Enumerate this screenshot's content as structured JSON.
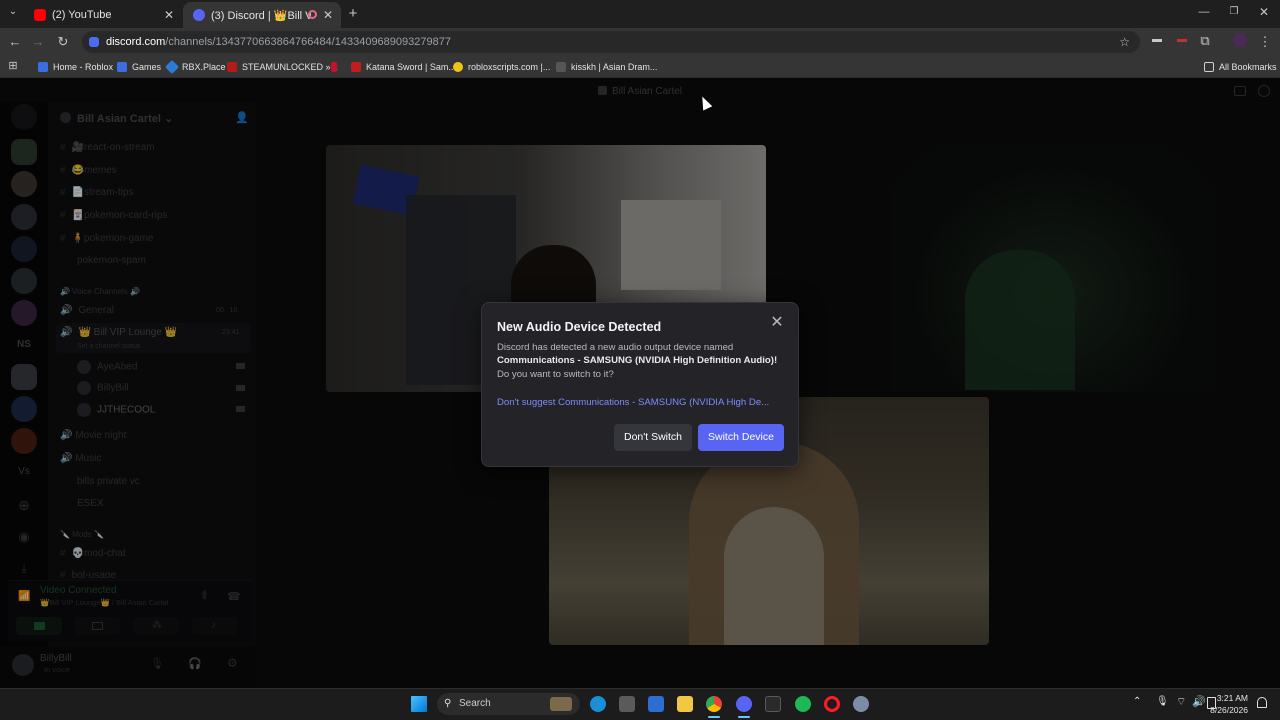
{
  "browser": {
    "tabs": [
      {
        "title": "(2) YouTube"
      },
      {
        "title": "(3) Discord | 👑Bill VIP Lou"
      }
    ],
    "url_host": "discord.com",
    "url_path": "/channels/1343770663864766484/1433409689093279877",
    "bookmarks": [
      {
        "label": "Home - Roblox"
      },
      {
        "label": "Games"
      },
      {
        "label": "RBX.Place"
      },
      {
        "label": "STEAMUNLOCKED »..."
      },
      {
        "label": "Katana Sword | Sam..."
      },
      {
        "label": "robloxscripts.com |..."
      },
      {
        "label": "kisskh | Asian Dram..."
      }
    ],
    "all_bookmarks": "All Bookmarks"
  },
  "discord": {
    "window_title": "Bill Asian Cartel",
    "server_name": "Bill Asian Cartel",
    "text_channels": [
      {
        "name": "🎥react-on-stream"
      },
      {
        "name": "😂memes"
      },
      {
        "name": "📄stream-tips"
      },
      {
        "name": "🃏pokemon-card-rips"
      },
      {
        "name": "🧍pokemon-game"
      },
      {
        "name": "pokemon-spam"
      }
    ],
    "voice_category": "🔊 Voice Channels 🔊",
    "voice_channels": [
      {
        "name": "General",
        "meta1": "00",
        "meta2": "10"
      },
      {
        "name": "👑 Bill VIP Lounge 👑",
        "meta1": "23:41",
        "status": "Set a channel status"
      }
    ],
    "voice_users": [
      {
        "name": "AyeAbed"
      },
      {
        "name": "BillyBill"
      },
      {
        "name": "JJTHECOOL"
      }
    ],
    "more_voice_channels": [
      {
        "name": "🔊 Movie night"
      },
      {
        "name": "🔊 Music"
      },
      {
        "name": "bills private vc"
      },
      {
        "name": "ESEX"
      }
    ],
    "mods_category": "🔪 Mods 🔪",
    "mod_channels": [
      {
        "name": "💀mod-chat"
      },
      {
        "name": "bot-usage"
      }
    ],
    "connection_status": "Video Connected",
    "connection_sub": "👑Bill VIP Lounge👑 / Bill Asian Cartel",
    "user_name": "BillyBill",
    "user_status": "In voice",
    "server_initials": [
      "NS",
      "Vs"
    ]
  },
  "modal": {
    "title": "New Audio Device Detected",
    "body_prefix": "Discord has detected a new audio output device named",
    "device_name": "Communications - SAMSUNG (NVIDIA High Definition Audio)!",
    "question": "Do you want to switch to it?",
    "suggest_link": "Don't suggest Communications - SAMSUNG (NVIDIA High De...",
    "dont_switch_label": "Don't Switch",
    "switch_label": "Switch Device",
    "accent_color": "#5865f2"
  },
  "taskbar": {
    "search_placeholder": "Search",
    "time": "3:21 AM",
    "date": "8/26/2026"
  }
}
